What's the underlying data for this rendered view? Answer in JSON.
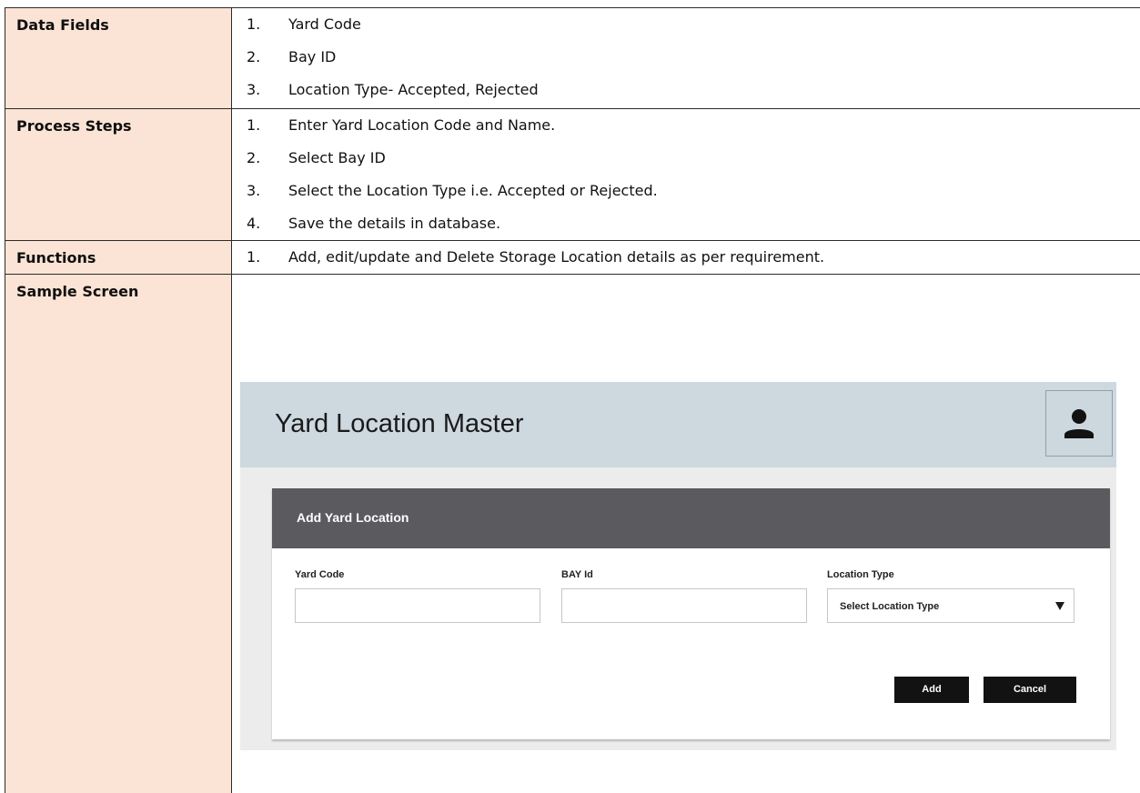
{
  "rows": {
    "data_fields": {
      "label": "Data Fields",
      "items": [
        {
          "num": "1.",
          "text": "Yard Code"
        },
        {
          "num": "2.",
          "text": "Bay ID"
        },
        {
          "num": "3.",
          "text": "Location Type- Accepted, Rejected"
        }
      ]
    },
    "process_steps": {
      "label": "Process Steps",
      "items": [
        {
          "num": "1.",
          "text": "Enter Yard Location Code and Name."
        },
        {
          "num": "2.",
          "text": "Select Bay ID"
        },
        {
          "num": "3.",
          "text": "Select the Location Type i.e. Accepted or Rejected."
        },
        {
          "num": "4.",
          "text": "Save the details in database."
        }
      ]
    },
    "functions": {
      "label": "Functions",
      "items": [
        {
          "num": "1.",
          "text": "Add, edit/update and Delete Storage Location details as per requirement."
        }
      ]
    },
    "sample_screen": {
      "label": "Sample Screen"
    }
  },
  "screen": {
    "title": "Yard Location Master",
    "profile_icon": "user-icon",
    "card_title": "Add  Yard Location",
    "fields": {
      "yard_code": {
        "label": "Yard Code",
        "value": ""
      },
      "bay_id": {
        "label": "BAY Id",
        "value": ""
      },
      "location_type": {
        "label": "Location Type",
        "selected": "Select Location Type"
      }
    },
    "buttons": {
      "add": "Add",
      "cancel": "Cancel"
    },
    "colors": {
      "header_bg": "#cdd8df",
      "card_header_bg": "#5a5a5f",
      "button_bg": "#121212",
      "label_cell_bg": "#fbe4d5"
    }
  }
}
